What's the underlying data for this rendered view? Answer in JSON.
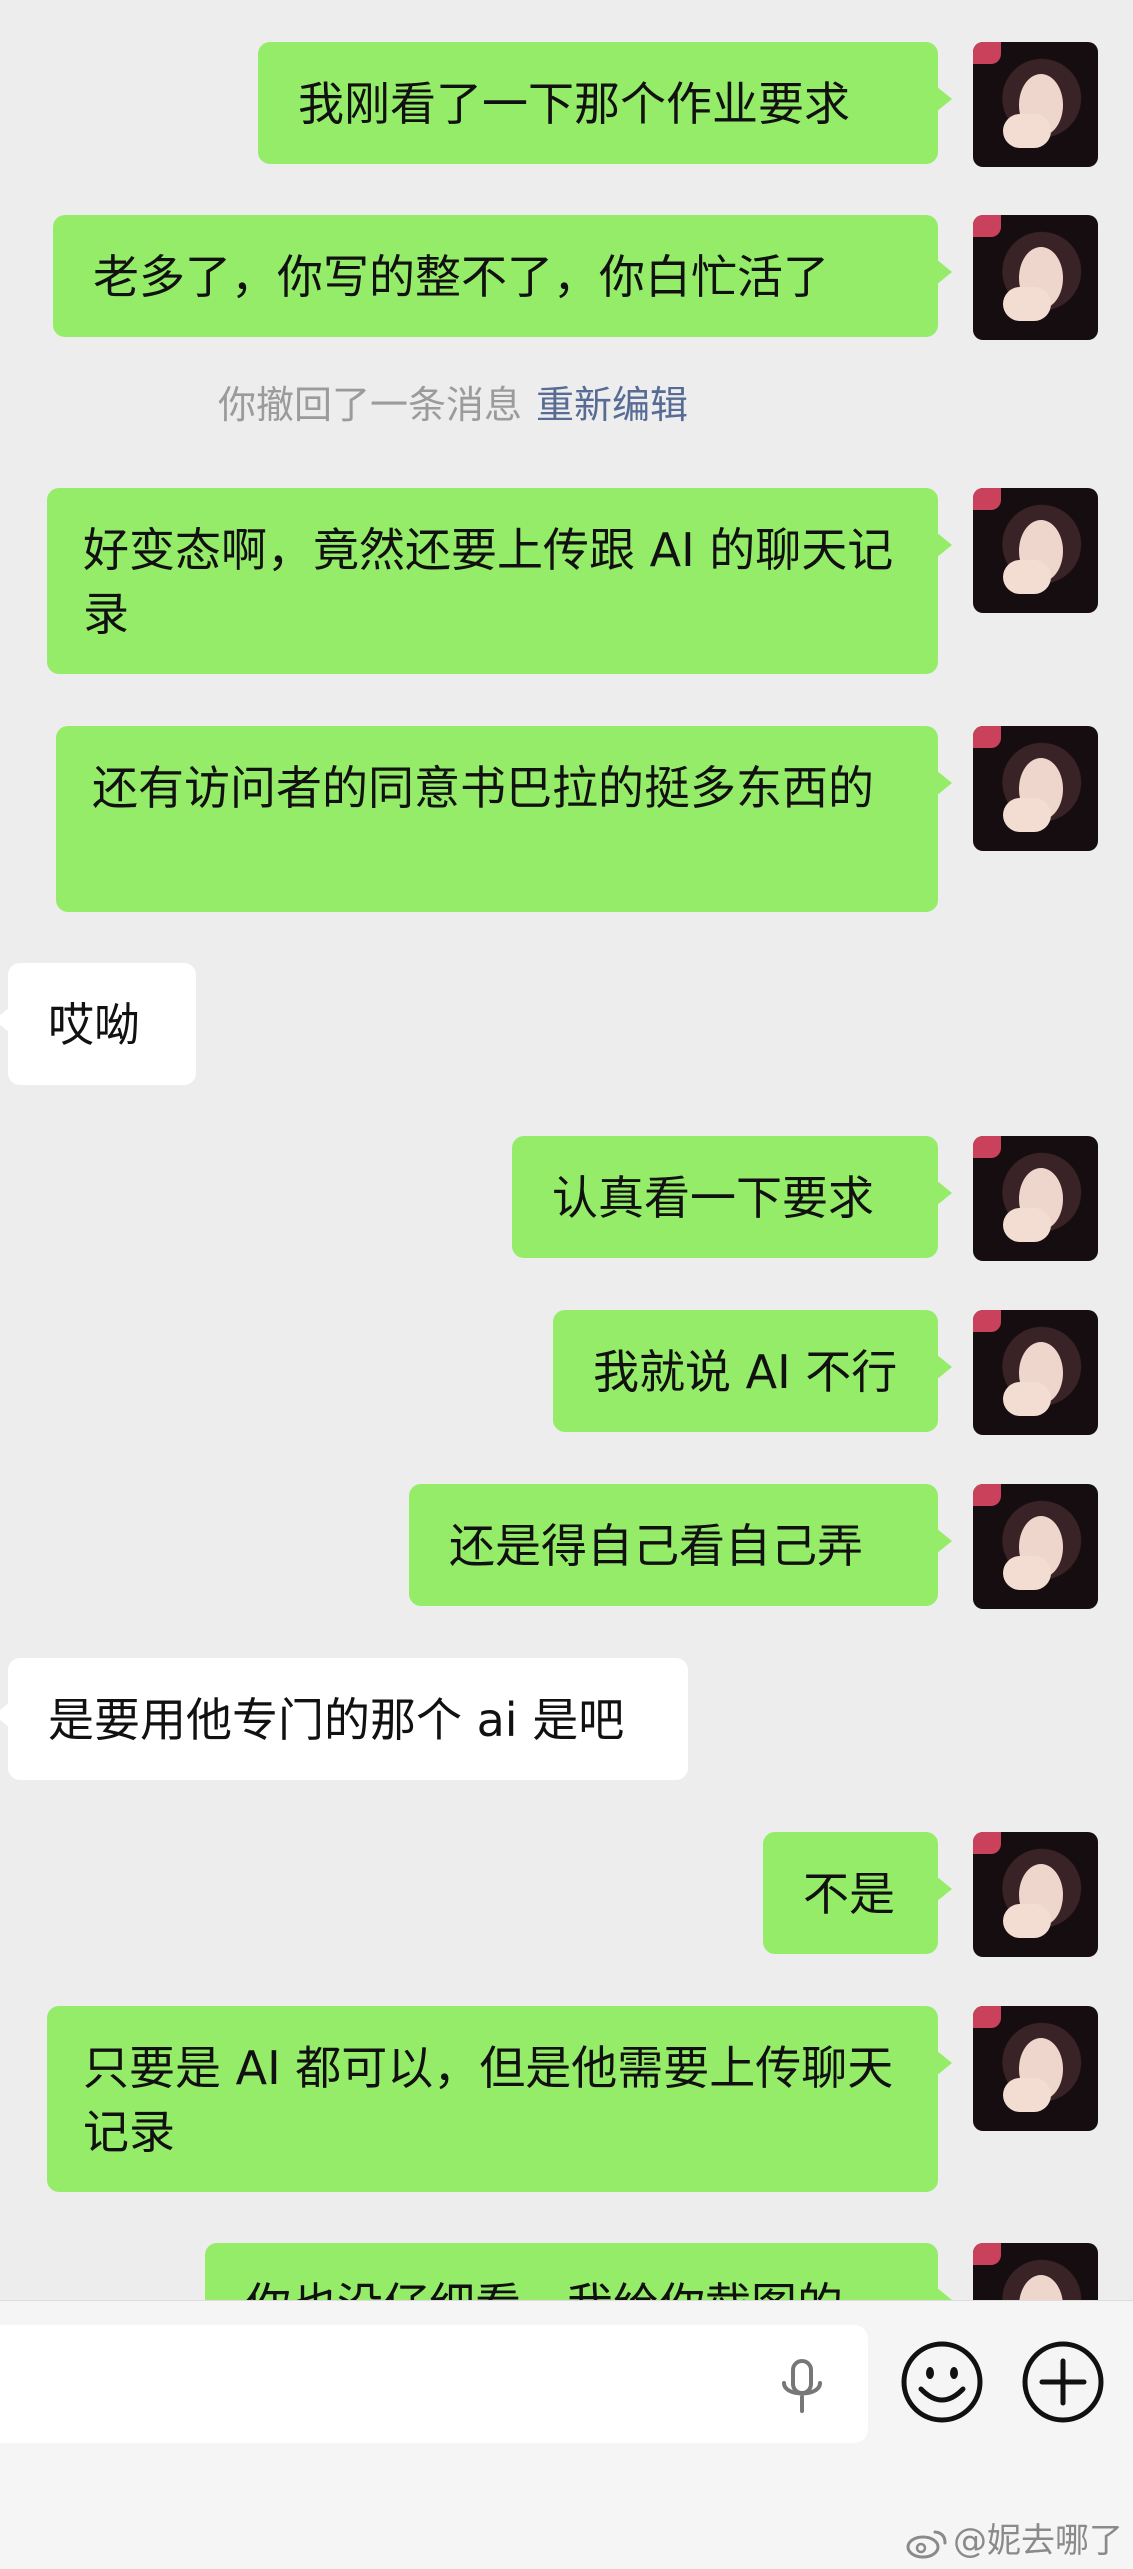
{
  "messages": [
    {
      "side": "right",
      "text": "我刚看了一下那个作业要求"
    },
    {
      "side": "right",
      "text": "老多了，你写的整不了，你白忙活了"
    },
    {
      "side": "system",
      "text": "你撤回了一条消息",
      "link": "重新编辑"
    },
    {
      "side": "right",
      "text": "好变态啊，竟然还要上传跟 AI 的聊天记录"
    },
    {
      "side": "right",
      "text": "还有访问者的同意书巴拉的挺多东西的"
    },
    {
      "side": "left",
      "text": "哎呦"
    },
    {
      "side": "right",
      "text": "认真看一下要求"
    },
    {
      "side": "right",
      "text": "我就说 AI 不行"
    },
    {
      "side": "right",
      "text": "还是得自己看自己弄"
    },
    {
      "side": "left",
      "text": "是要用他专门的那个 ai 是吧"
    },
    {
      "side": "right",
      "text": "不是"
    },
    {
      "side": "right",
      "text": "只要是 AI 都可以，但是他需要上传聊天记录"
    },
    {
      "side": "right",
      "text": "你也没仔细看，我给你截图的"
    }
  ],
  "input": {
    "value": "",
    "placeholder": ""
  },
  "icons": {
    "mic": "microphone-icon",
    "emoji": "emoji-icon",
    "more": "plus-circle-icon"
  },
  "watermark": "@妮去哪了",
  "colors": {
    "sent_bubble": "#95ec69",
    "received_bubble": "#ffffff",
    "background": "#ededed",
    "system_link": "#576b95"
  }
}
